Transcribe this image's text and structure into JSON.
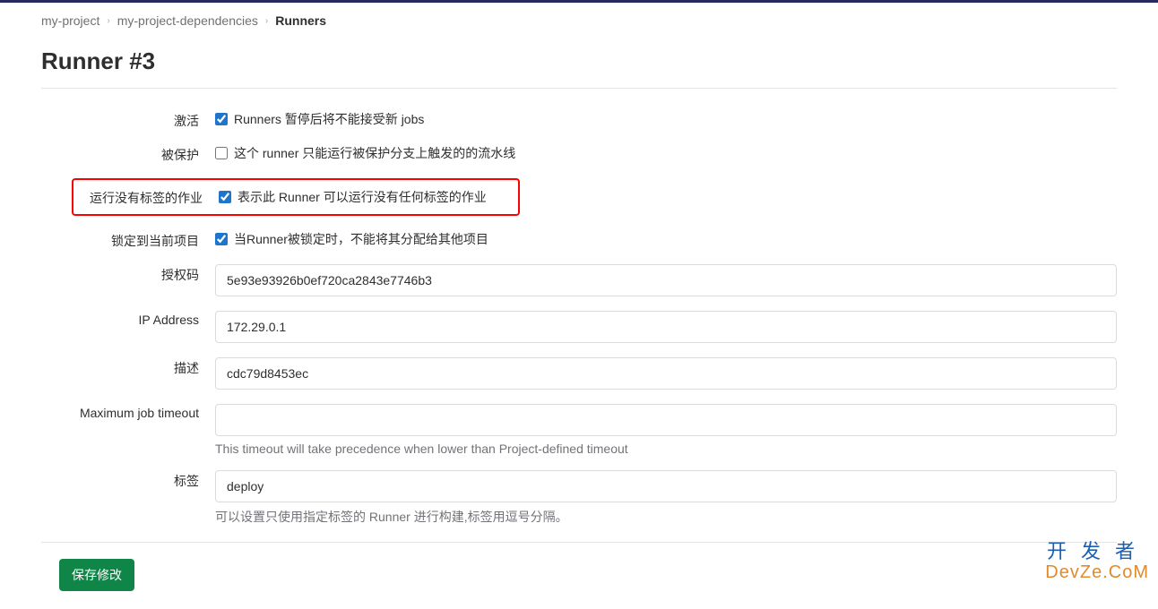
{
  "breadcrumb": {
    "item1": "my-project",
    "item2": "my-project-dependencies",
    "item3": "Runners"
  },
  "page_title": "Runner #3",
  "form": {
    "active": {
      "label": "激活",
      "desc": "Runners 暂停后将不能接受新 jobs",
      "checked": true
    },
    "protected": {
      "label": "被保护",
      "desc": "这个 runner 只能运行被保护分支上触发的的流水线",
      "checked": false
    },
    "run_untagged": {
      "label": "运行没有标签的作业",
      "desc": "表示此 Runner 可以运行没有任何标签的作业",
      "checked": true
    },
    "locked": {
      "label": "锁定到当前项目",
      "desc": "当Runner被锁定时，不能将其分配给其他项目",
      "checked": true
    },
    "token": {
      "label": "授权码",
      "value": "5e93e93926b0ef720ca2843e7746b3"
    },
    "ip": {
      "label": "IP Address",
      "value": "172.29.0.1"
    },
    "description": {
      "label": "描述",
      "value": "cdc79d8453ec"
    },
    "timeout": {
      "label": "Maximum job timeout",
      "value": "",
      "help": "This timeout will take precedence when lower than Project-defined timeout"
    },
    "tags": {
      "label": "标签",
      "value": "deploy",
      "help": "可以设置只使用指定标签的 Runner 进行构建,标签用逗号分隔。"
    }
  },
  "save_button": "保存修改",
  "watermark": {
    "line1": "开发者",
    "line2": "DevZe.CoM"
  }
}
